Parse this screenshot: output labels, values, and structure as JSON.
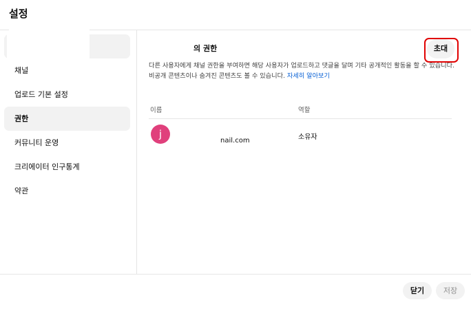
{
  "header": {
    "title": "설정"
  },
  "sidebar": {
    "items": [
      {
        "label": ""
      },
      {
        "label": "채널"
      },
      {
        "label": "업로드 기본 설정"
      },
      {
        "label": "권한"
      },
      {
        "label": "커뮤니티 운영"
      },
      {
        "label": "크리에이터 인구통계"
      },
      {
        "label": "약관"
      }
    ],
    "active": "권한"
  },
  "main": {
    "section_title": "의 권한",
    "invite_label": "초대",
    "description": "다른 사용자에게 채널 권한을 부여하면 해당 사용자가 업로드하고 댓글을 달며 기타 공개적인 활동을 할 수 있습니다. 비공개 콘텐츠이나 숨겨진 콘텐츠도 볼 수 있습니다.",
    "learn_more": "자세히 알아보기",
    "table": {
      "headers": {
        "name": "이름",
        "role": "역할"
      },
      "rows": [
        {
          "avatar": "j",
          "email": "nail.com",
          "role": "소유자"
        }
      ]
    }
  },
  "footer": {
    "close_label": "닫기",
    "save_label": "저장"
  },
  "colors": {
    "accent": "#065fd4",
    "avatar": "#e0407c",
    "highlight": "#e00000"
  }
}
